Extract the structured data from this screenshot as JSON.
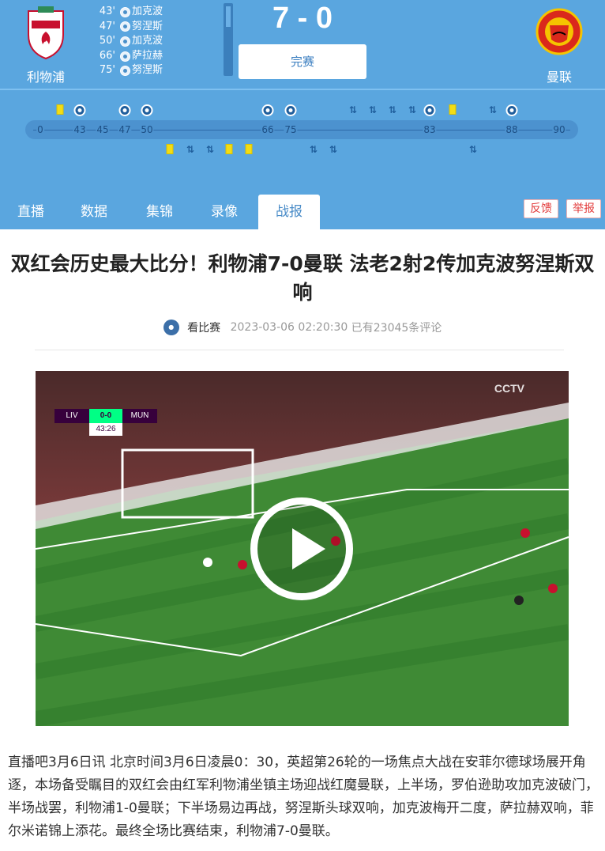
{
  "match": {
    "home": {
      "name": "利物浦",
      "crest": "liverpool-crest"
    },
    "away": {
      "name": "曼联",
      "crest": "manchester-united-crest"
    },
    "score": "7 - 0",
    "status": "完赛",
    "home_scorers": [
      {
        "minute": "43'",
        "player": "加克波"
      },
      {
        "minute": "47'",
        "player": "努涅斯"
      },
      {
        "minute": "50'",
        "player": "加克波"
      },
      {
        "minute": "66'",
        "player": "萨拉赫"
      },
      {
        "minute": "75'",
        "player": "努涅斯"
      }
    ]
  },
  "timeline": {
    "ticks": [
      "0",
      "43",
      "45",
      "47",
      "50",
      "66",
      "75",
      "83",
      "88",
      "90"
    ],
    "home_events": [
      "yellow-card",
      "goal",
      "goal",
      "goal",
      "goal",
      "goal",
      "substitution",
      "substitution",
      "substitution",
      "substitution",
      "goal",
      "yellow-card",
      "substitution",
      "goal"
    ],
    "away_events": [
      "yellow-card",
      "substitution",
      "substitution",
      "yellow-card",
      "yellow-card",
      "substitution",
      "substitution",
      "substitution"
    ]
  },
  "tabs": [
    "直播",
    "数据",
    "集锦",
    "录像",
    "战报"
  ],
  "active_tab": "战报",
  "actions": {
    "feedback": "反馈",
    "report": "举报"
  },
  "article": {
    "title": "双红会历史最大比分！利物浦7-0曼联 法老2射2传加克波努涅斯双响",
    "source_icon_text": "看比赛",
    "source": "看比赛",
    "datetime": "2023-03-06 02:20:30",
    "comments": "已有23045条评论",
    "body": "直播吧3月6日讯 北京时间3月6日凌晨0：30，英超第26轮的一场焦点大战在安菲尔德球场展开角逐，本场备受瞩目的双红会由红军利物浦坐镇主场迎战红魔曼联，上半场，罗伯逊助攻加克波破门，半场战罢，利物浦1-0曼联；下半场易边再战，努涅斯头球双响，加克波梅开二度，萨拉赫双响，菲尔米诺锦上添花。最终全场比赛结束，利物浦7-0曼联。"
  },
  "video": {
    "scorebug": {
      "home": "LIV",
      "away": "MUN",
      "score": "0-0",
      "clock": "43:26"
    },
    "broadcaster": "CCTV"
  },
  "colors": {
    "header_bg": "#5aa6df",
    "liverpool_red": "#c8102e",
    "united_red": "#da291c",
    "tab_active_text": "#4a8cc8"
  }
}
